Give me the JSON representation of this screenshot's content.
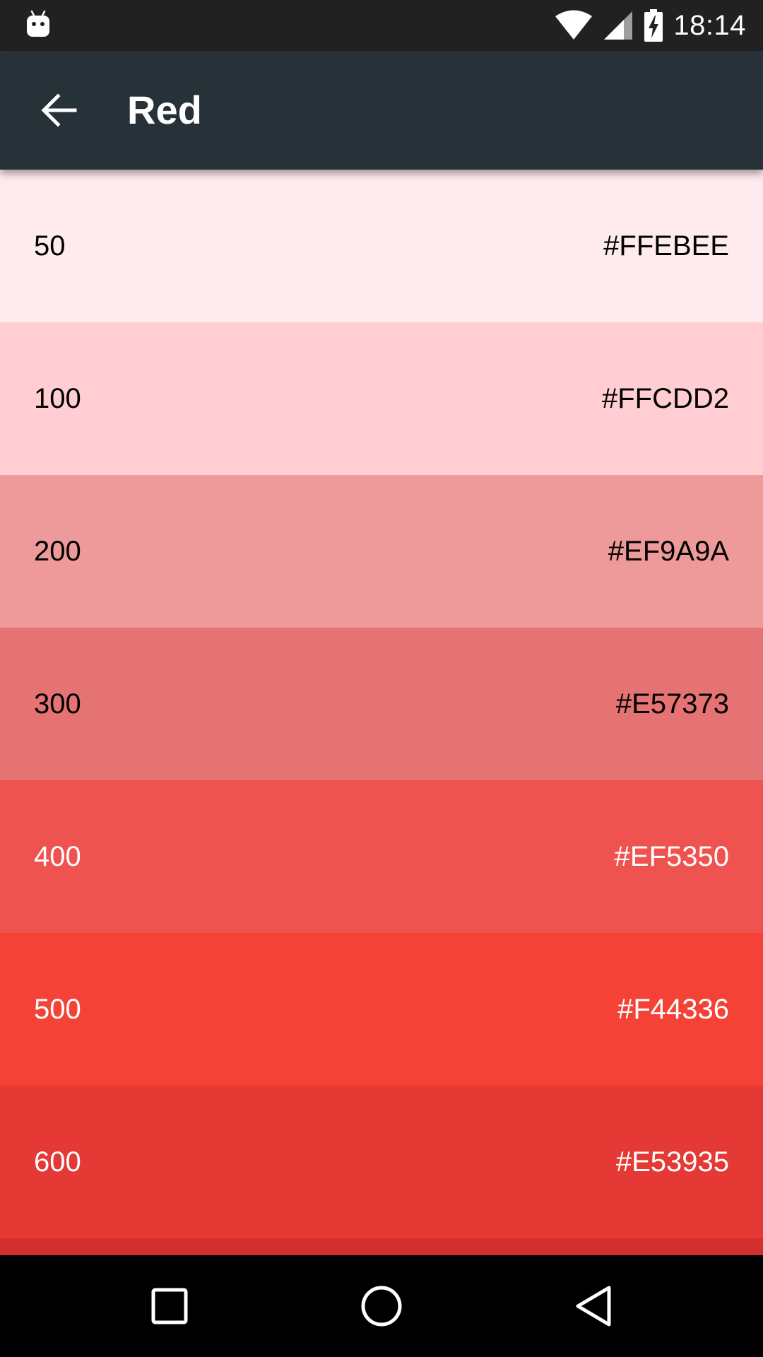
{
  "status_bar": {
    "time": "18:14",
    "icons": [
      "android-notification-icon",
      "wifi-icon",
      "signal-icon",
      "battery-charging-icon"
    ]
  },
  "app_bar": {
    "title": "Red",
    "back_icon": "arrow-back-icon",
    "background": "#263238"
  },
  "colors": [
    {
      "shade": "50",
      "hex": "#FFEBEE",
      "background": "#FFEBEE",
      "text_color": "#000000"
    },
    {
      "shade": "100",
      "hex": "#FFCDD2",
      "background": "#FFCDD2",
      "text_color": "#000000"
    },
    {
      "shade": "200",
      "hex": "#EF9A9A",
      "background": "#EF9A9A",
      "text_color": "#000000"
    },
    {
      "shade": "300",
      "hex": "#E57373",
      "background": "#E57373",
      "text_color": "#000000"
    },
    {
      "shade": "400",
      "hex": "#EF5350",
      "background": "#EF5350",
      "text_color": "#FFFFFF"
    },
    {
      "shade": "500",
      "hex": "#F44336",
      "background": "#F44336",
      "text_color": "#FFFFFF"
    },
    {
      "shade": "600",
      "hex": "#E53935",
      "background": "#E53935",
      "text_color": "#FFFFFF"
    }
  ],
  "partial_row_color": "#D32F2F",
  "nav_bar": {
    "icons": [
      "recents-square-icon",
      "home-circle-icon",
      "back-triangle-icon"
    ]
  }
}
